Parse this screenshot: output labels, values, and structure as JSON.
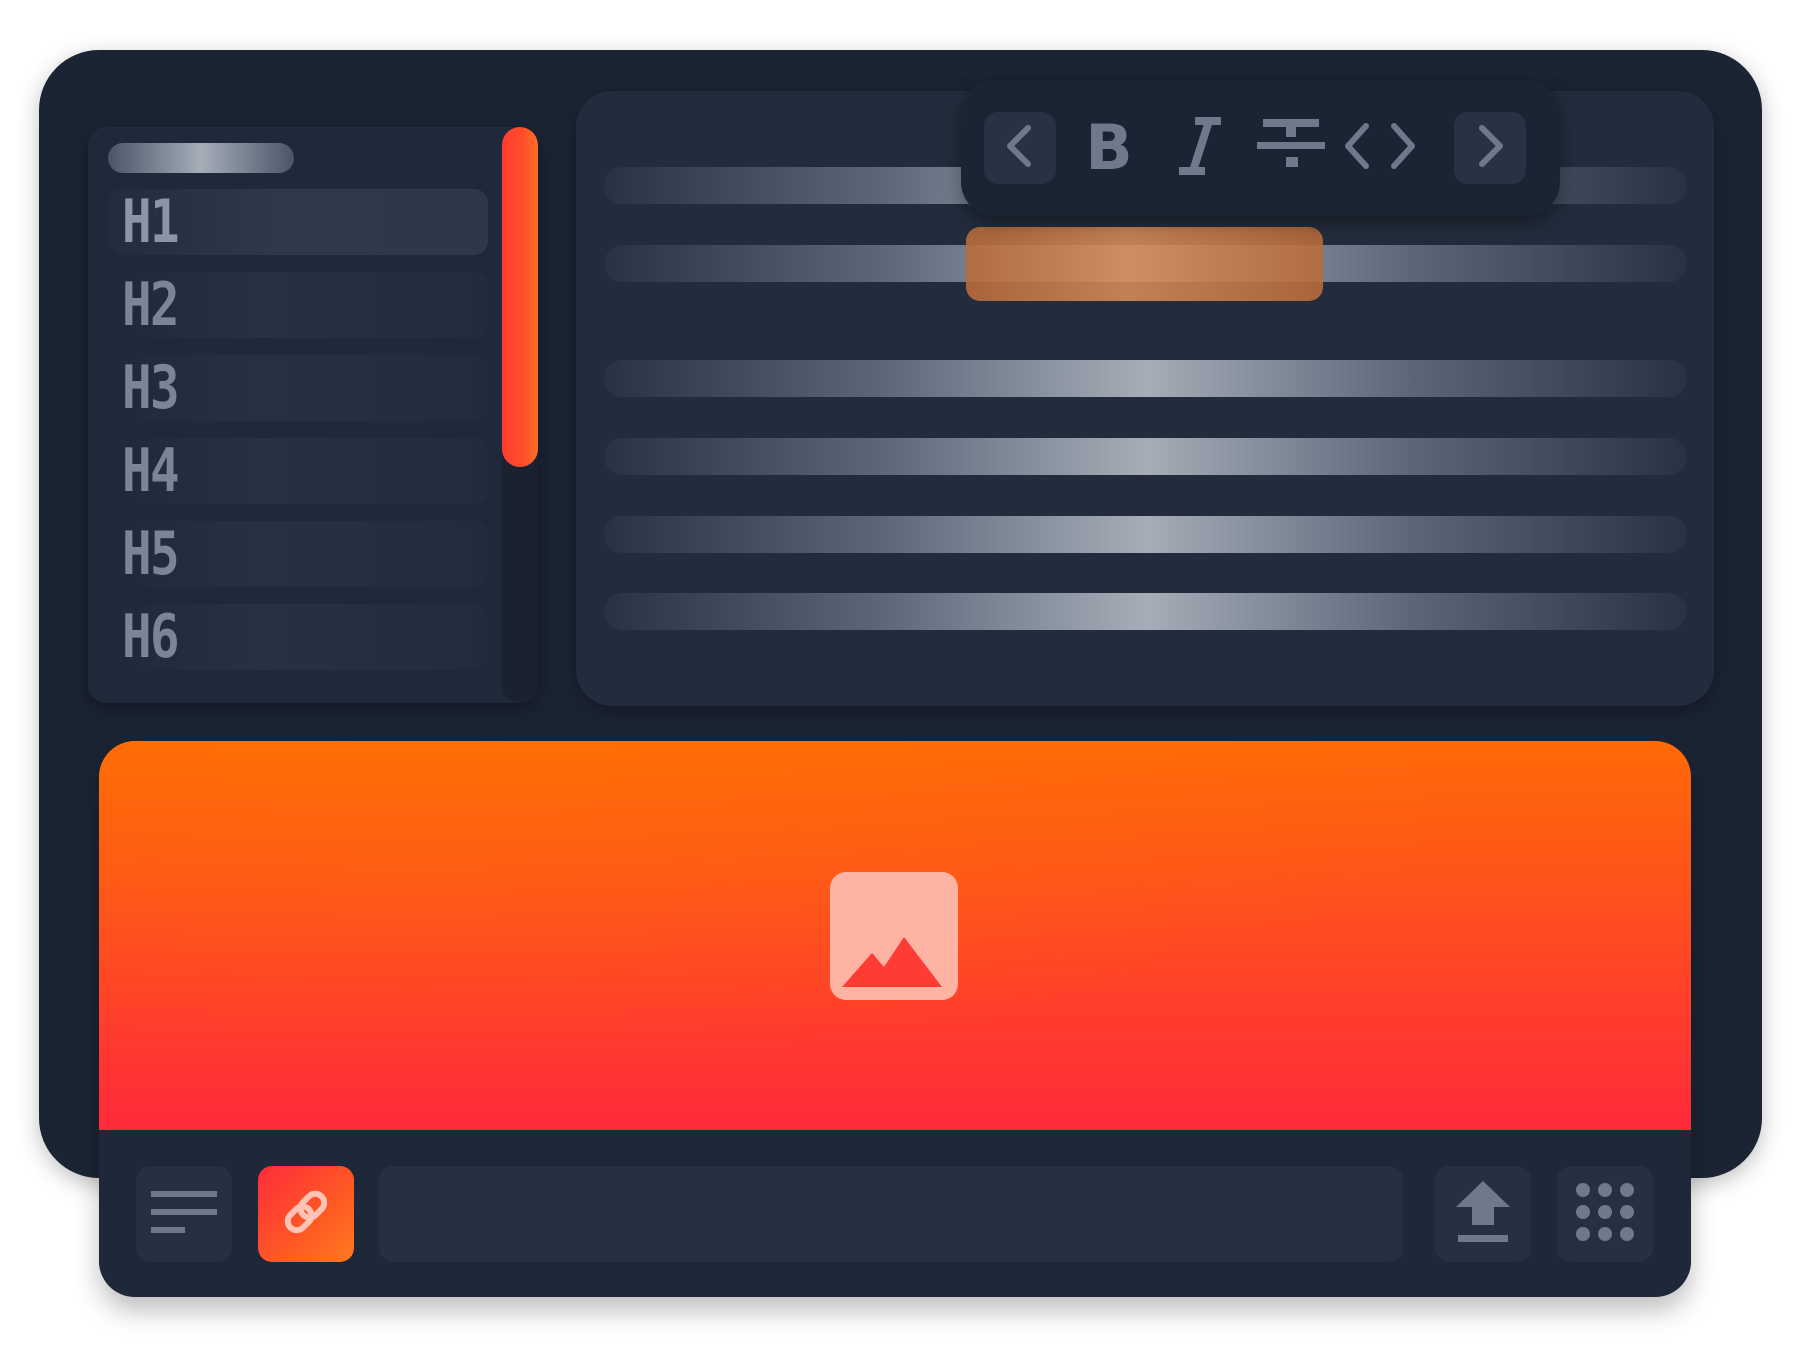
{
  "headings": {
    "items": [
      {
        "label": "H1",
        "active": true
      },
      {
        "label": "H2",
        "active": false
      },
      {
        "label": "H3",
        "active": false
      },
      {
        "label": "H4",
        "active": false
      },
      {
        "label": "H5",
        "active": false
      },
      {
        "label": "H6",
        "active": false
      }
    ]
  },
  "format_toolbar": {
    "buttons": [
      "prev-icon",
      "bold-icon",
      "italic-icon",
      "strikethrough-icon",
      "code-icon",
      "next-icon"
    ],
    "bold_glyph": "B",
    "italic_glyph": "I"
  },
  "bottom_bar": {
    "buttons": [
      "align-left-icon",
      "link-icon",
      "upload-icon",
      "grid-icon"
    ],
    "url_value": ""
  },
  "colors": {
    "accent": "#ff4f2b",
    "accent_orange": "#ff6a07",
    "accent_red": "#ff2a3a",
    "window_bg": "#1b2433",
    "icon_gray": "#6e7a8c"
  }
}
